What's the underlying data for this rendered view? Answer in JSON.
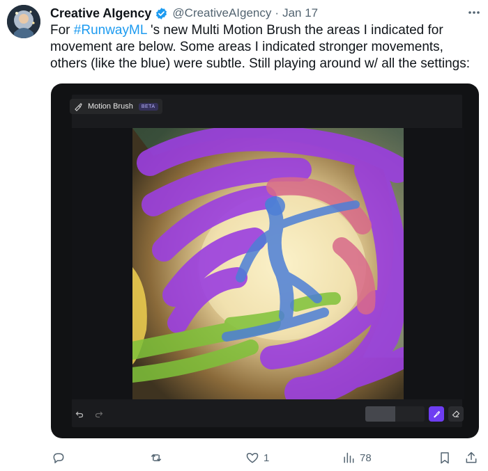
{
  "tweet": {
    "author_name": "Creative AIgency",
    "handle": "@CreativeAIgency",
    "separator": "·",
    "date": "Jan 17",
    "text_prefix": "For ",
    "hashtag": "#RunwayML",
    "text_suffix": " 's new Multi Motion Brush the areas I indicated for movement are below.  Some areas I indicated stronger movements, others (like the blue) were subtle.  Still playing around w/ all the settings:"
  },
  "media": {
    "tool_title": "Motion Brush",
    "badge": "BETA",
    "brush_strength_fraction": 0.5,
    "colors": {
      "accent": "#6e3df2",
      "purple_stroke": "#9b3fe0",
      "blue_stroke": "#4d7fd6",
      "green_stroke": "#7fc23a",
      "pink_stroke": "#d86a8a",
      "yellow_stroke": "#f0d050"
    }
  },
  "actions": {
    "reply_count": "",
    "retweet_count": "",
    "like_count": "1",
    "views_count": "78"
  },
  "colors": {
    "link": "#1d9bf0",
    "secondary_text": "#536471",
    "verified": "#1d9bf0"
  }
}
